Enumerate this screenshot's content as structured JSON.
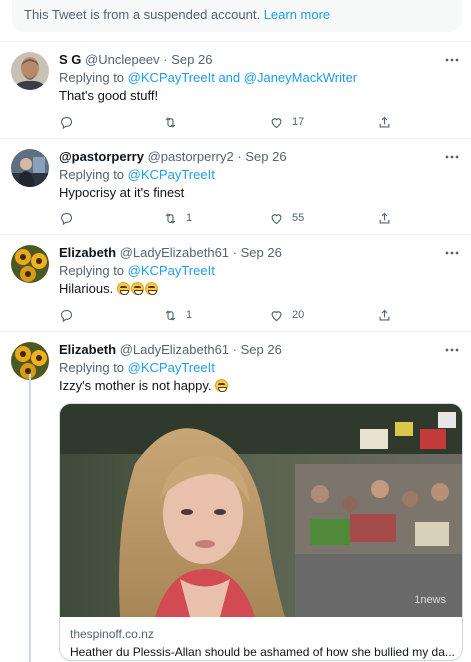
{
  "notice": {
    "text": "This Tweet is from a suspended account.",
    "link": "Learn more"
  },
  "tweets": [
    {
      "name": "S G",
      "handle": "@Unclepeev",
      "sep": "·",
      "date": "Sep 26",
      "replying_prefix": "Replying to",
      "mentions": [
        "@KCPayTreeIt",
        "and",
        "@JaneyMackWriter"
      ],
      "text": "That's good stuff!",
      "replies": "",
      "retweets": "",
      "likes": "17"
    },
    {
      "name": "@pastorperry",
      "handle": "@pastorperry2",
      "sep": "·",
      "date": "Sep 26",
      "replying_prefix": "Replying to",
      "mentions": [
        "@KCPayTreeIt"
      ],
      "text": "Hypocrisy at it's finest",
      "replies": "",
      "retweets": "1",
      "likes": "55"
    },
    {
      "name": "Elizabeth",
      "handle": "@LadyElizabeth61",
      "sep": "·",
      "date": "Sep 26",
      "replying_prefix": "Replying to",
      "mentions": [
        "@KCPayTreeIt"
      ],
      "text": "Hilarious.",
      "emoji": "😁😁😁",
      "replies": "",
      "retweets": "1",
      "likes": "20"
    },
    {
      "name": "Elizabeth",
      "handle": "@LadyElizabeth61",
      "sep": "·",
      "date": "Sep 26",
      "replying_prefix": "Replying to",
      "mentions": [
        "@KCPayTreeIt"
      ],
      "text": "Izzy's mother is not happy.",
      "emoji": "😁",
      "card": {
        "domain": "thespinoff.co.nz",
        "title": "Heather du Plessis-Allan should be ashamed of how she bullied my da...",
        "watermark": "1news"
      }
    }
  ],
  "icons": {
    "reply": "reply-icon",
    "retweet": "retweet-icon",
    "like": "like-icon",
    "share": "share-icon",
    "more": "more-icon"
  },
  "colors": {
    "accent": "#1d9bf0",
    "secondary_text": "#536471",
    "border": "#eff3f4"
  }
}
